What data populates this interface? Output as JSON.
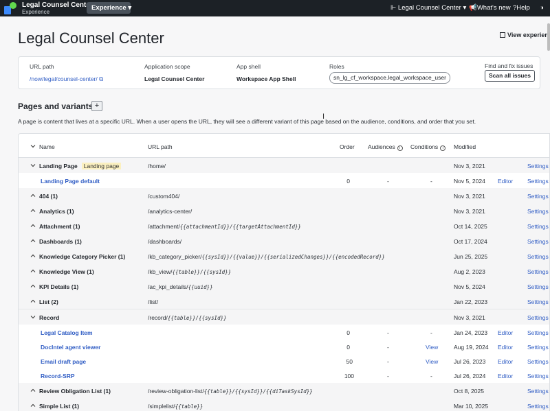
{
  "topbar": {
    "app_name": "Legal Counsel Center",
    "app_sub": "Experience",
    "experience_btn": "Experience",
    "app_selector": "Legal Counsel Center",
    "whats_new": "What's new",
    "help": "Help"
  },
  "page": {
    "title": "Legal Counsel Center",
    "view_experience": "View experience"
  },
  "info": {
    "url_path_label": "URL path",
    "url_path_value": "/now/legal/counsel-center/",
    "scope_label": "Application scope",
    "scope_value": "Legal Counsel Center",
    "shell_label": "App shell",
    "shell_value": "Workspace App Shell",
    "roles_label": "Roles",
    "roles_value": "sn_lg_cf_workspace.legal_workspace_user",
    "fix_label": "Find and fix issues",
    "scan_btn": "Scan all issues"
  },
  "section": {
    "title": "Pages and variants",
    "description": "A page is content that lives at a specific URL. When a user opens the URL, they will see a different variant of this page based on the audience, conditions, and order that you set."
  },
  "table": {
    "headers": {
      "name": "Name",
      "url": "URL path",
      "order": "Order",
      "audiences": "Audiences",
      "conditions": "Conditions",
      "modified": "Modified"
    },
    "rows": [
      {
        "name": "Landing Page",
        "badge": "Landing page",
        "url": "/home/",
        "mod": "Nov 3, 2021",
        "settings": "Settings"
      },
      {
        "name": "Landing Page default",
        "order": "0",
        "aud": "-",
        "cond": "-",
        "mod": "Nov 5, 2024",
        "editor": "Editor",
        "settings": "Settings"
      },
      {
        "name": "404 (1)",
        "url": "/custom404/",
        "mod": "Nov 3, 2021",
        "settings": "Settings"
      },
      {
        "name": "Analytics (1)",
        "url": "/analytics-center/",
        "mod": "Nov 3, 2021",
        "settings": "Settings"
      },
      {
        "name": "Attachment (1)",
        "url_a": "/attachment/",
        "url_b": "{{attachmentId}}/{{targetAttachmentId}}",
        "mod": "Oct 14, 2025",
        "settings": "Settings"
      },
      {
        "name": "Dashboards (1)",
        "url": "/dashboards/",
        "mod": "Oct 17, 2024",
        "settings": "Settings"
      },
      {
        "name": "Knowledge Category Picker (1)",
        "url_a": "/kb_category_picker/",
        "url_b": "{{sysId}}/{{value}}/{{serializedChanges}}/{{encodedRecord}}",
        "mod": "Jun 25, 2025",
        "settings": "Settings"
      },
      {
        "name": "Knowledge View (1)",
        "url_a": "/kb_view/",
        "url_b": "{{table}}/{{sysId}}",
        "mod": "Aug 2, 2023",
        "settings": "Settings"
      },
      {
        "name": "KPI Details (1)",
        "url_a": "/ac_kpi_details/",
        "url_b": "{{uuid}}",
        "mod": "Nov 5, 2024",
        "settings": "Settings"
      },
      {
        "name": "List (2)",
        "url": "/list/",
        "mod": "Jan 22, 2023",
        "settings": "Settings"
      },
      {
        "name": "Record",
        "url_a": "/record/",
        "url_b": "{{table}}/{{sysId}}",
        "mod": "Nov 3, 2021",
        "settings": "Settings"
      },
      {
        "name": "Legal Catalog Item",
        "order": "0",
        "aud": "-",
        "cond": "-",
        "mod": "Jan 24, 2023",
        "editor": "Editor",
        "settings": "Settings"
      },
      {
        "name": "DocIntel agent viewer",
        "order": "0",
        "aud": "-",
        "view": "View",
        "mod": "Aug 19, 2024",
        "editor": "Editor",
        "settings": "Settings"
      },
      {
        "name": "Email draft page",
        "order": "50",
        "aud": "-",
        "view": "View",
        "mod": "Jul 26, 2023",
        "editor": "Editor",
        "settings": "Settings"
      },
      {
        "name": "Record-SRP",
        "order": "100",
        "aud": "-",
        "cond": "-",
        "mod": "Jul 26, 2024",
        "editor": "Editor",
        "settings": "Settings"
      },
      {
        "name": "Review Obligation List (1)",
        "url_a": "/review-obligation-list/",
        "url_b": "{{table}}/{{sysId}}/{{diTaskSysId}}",
        "mod": "Oct 8, 2025",
        "settings": "Settings"
      },
      {
        "name": "Simple List (1)",
        "url_a": "/simplelist/",
        "url_b": "{{table}}",
        "mod": "Mar 10, 2025",
        "settings": "Settings"
      }
    ]
  }
}
